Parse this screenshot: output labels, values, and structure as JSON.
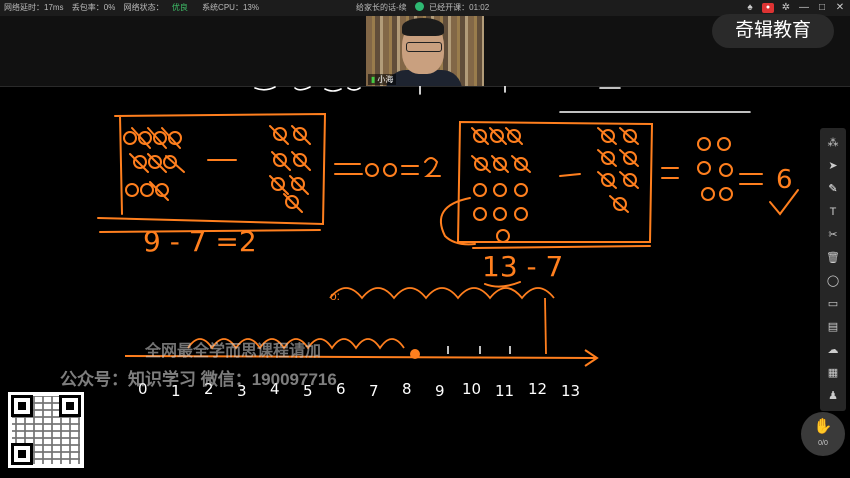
{
  "topbar": {
    "latency": "网络延时：17ms",
    "packet_loss": "丢包率：0%",
    "network_label": "网络状态：",
    "network_value": "优良",
    "cpu": "系统CPU：13%",
    "lesson_title": "给家长的话-续",
    "elapsed": "已经开课：01:02"
  },
  "camera": {
    "name": "小海"
  },
  "brand": {
    "logo_text": "奇辑教育"
  },
  "toolbar": {
    "tools": [
      "pointer-tool",
      "laser-tool",
      "pen-tool",
      "text-tool",
      "scissors-tool",
      "delete-tool",
      "eraser-tool",
      "formula-tool",
      "chat-tool",
      "cloud-tool",
      "toolbox-tool",
      "members-tool"
    ]
  },
  "hand_raise": {
    "count": "0/0"
  },
  "watermark": {
    "line1": "全网最全学而思课程请加",
    "line2": "公众号：知识学习 微信：190097716"
  },
  "board": {
    "left_problem": {
      "result": "=00=2",
      "bottom": "9 - 7 =2"
    },
    "right_problem": {
      "result": "=",
      "answer": "6",
      "bottom": "13 - 7"
    },
    "number_line": [
      "0",
      "1",
      "2",
      "3",
      "4",
      "5",
      "6",
      "7",
      "8",
      "9",
      "10",
      "11",
      "12",
      "13"
    ]
  },
  "colors": {
    "ink_orange": "#ff7f1e",
    "ink_white": "#ffffff",
    "toolbar_bg": "#262626",
    "good_status": "#3fc46a"
  }
}
